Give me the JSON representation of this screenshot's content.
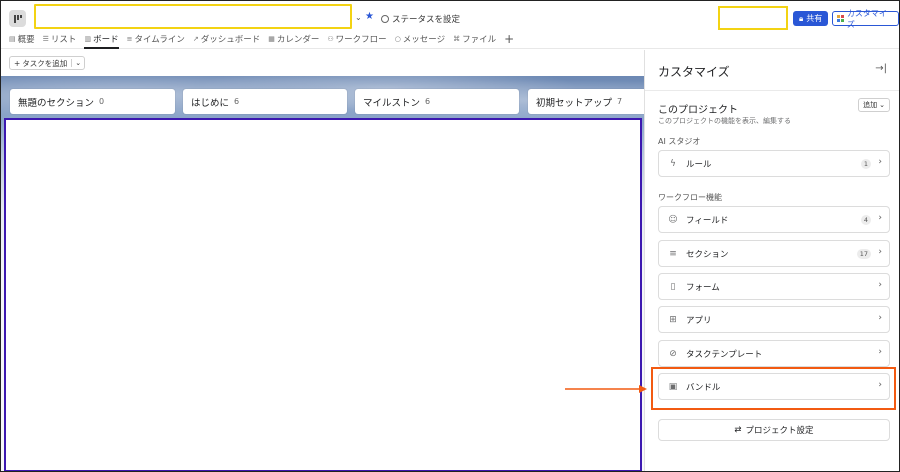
{
  "header": {
    "status_label": "ステータスを設定",
    "share_label": "共有",
    "customize_label": "カスタマイズ",
    "tabs": [
      {
        "icon": "overview-icon",
        "label": "概要"
      },
      {
        "icon": "list-icon",
        "label": "リスト"
      },
      {
        "icon": "board-icon",
        "label": "ボード"
      },
      {
        "icon": "timeline-icon",
        "label": "タイムライン"
      },
      {
        "icon": "dashboard-icon",
        "label": "ダッシュボード"
      },
      {
        "icon": "calendar-icon",
        "label": "カレンダー"
      },
      {
        "icon": "workflow-icon",
        "label": "ワークフロー"
      },
      {
        "icon": "message-icon",
        "label": "メッセージ"
      },
      {
        "icon": "file-icon",
        "label": "ファイル"
      }
    ],
    "active_tab": "ボード"
  },
  "toolbar": {
    "add_task_label": "タスクを追加"
  },
  "board": {
    "columns": [
      {
        "name": "無題のセクション",
        "count": "0"
      },
      {
        "name": "はじめに",
        "count": "6"
      },
      {
        "name": "マイルストン",
        "count": "6"
      },
      {
        "name": "初期セットアップ",
        "count": "7"
      }
    ]
  },
  "panel": {
    "title": "カスタマイズ",
    "project_title": "このプロジェクト",
    "project_sub": "このプロジェクトの機能を表示、編集する",
    "add_label": "追加",
    "ai_label": "AI スタジオ",
    "workflow_label": "ワークフロー機能",
    "rule": {
      "label": "ルール",
      "count": "1"
    },
    "items": [
      {
        "icon": "field-icon",
        "label": "フィールド",
        "count": "4"
      },
      {
        "icon": "section-icon",
        "label": "セクション",
        "count": "17"
      },
      {
        "icon": "form-icon",
        "label": "フォーム",
        "count": ""
      },
      {
        "icon": "apps-icon",
        "label": "アプリ",
        "count": ""
      },
      {
        "icon": "task-template-icon",
        "label": "タスクテンプレート",
        "count": ""
      },
      {
        "icon": "bundle-icon",
        "label": "バンドル",
        "count": ""
      }
    ],
    "settings_label": "プロジェクト設定"
  },
  "colors": {
    "accent": "#2a57d6",
    "highlight_yellow": "#f3d313",
    "highlight_orange": "#f25a11",
    "board_outline": "#3c18b0"
  }
}
